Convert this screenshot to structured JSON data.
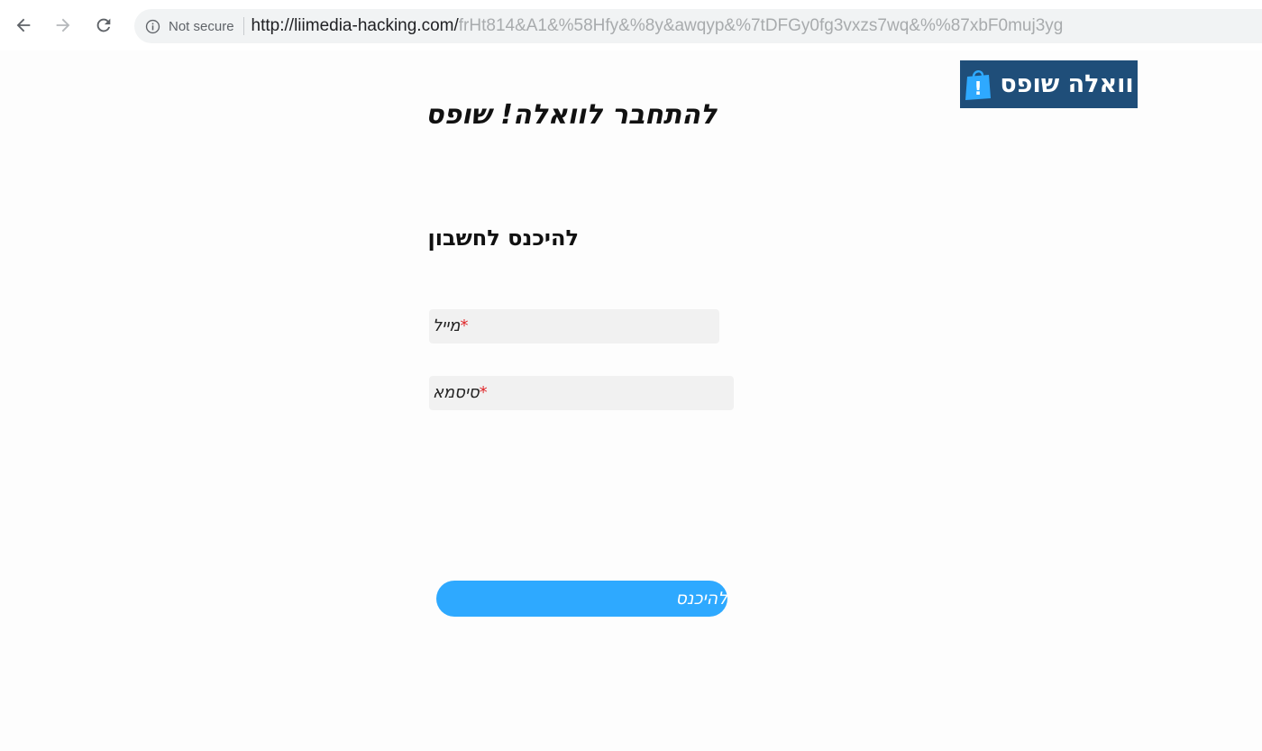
{
  "browser": {
    "security_label": "Not secure",
    "url_host": "http://liimedia-hacking.com/",
    "url_path": "frHt814&A1&%58Hfy&%8y&awqyp&%7tDFGy0fg3vxzs7wq&%%87xbF0muj3yg",
    "icons": [
      "back-arrow-icon",
      "forward-arrow-icon",
      "reload-icon",
      "info-icon"
    ]
  },
  "logo": {
    "text": "וואלה שופס",
    "bag_mark": "!",
    "bg_color": "#1f4e79"
  },
  "page": {
    "title": "להתחבר לוואלה! שופס",
    "section_title": "להיכנס לחשבון"
  },
  "form": {
    "email_label": "מייל",
    "password_label": "סיסמא",
    "required_mark": "*",
    "submit_label": "להיכנס",
    "accent_color": "#2ea9ff"
  }
}
